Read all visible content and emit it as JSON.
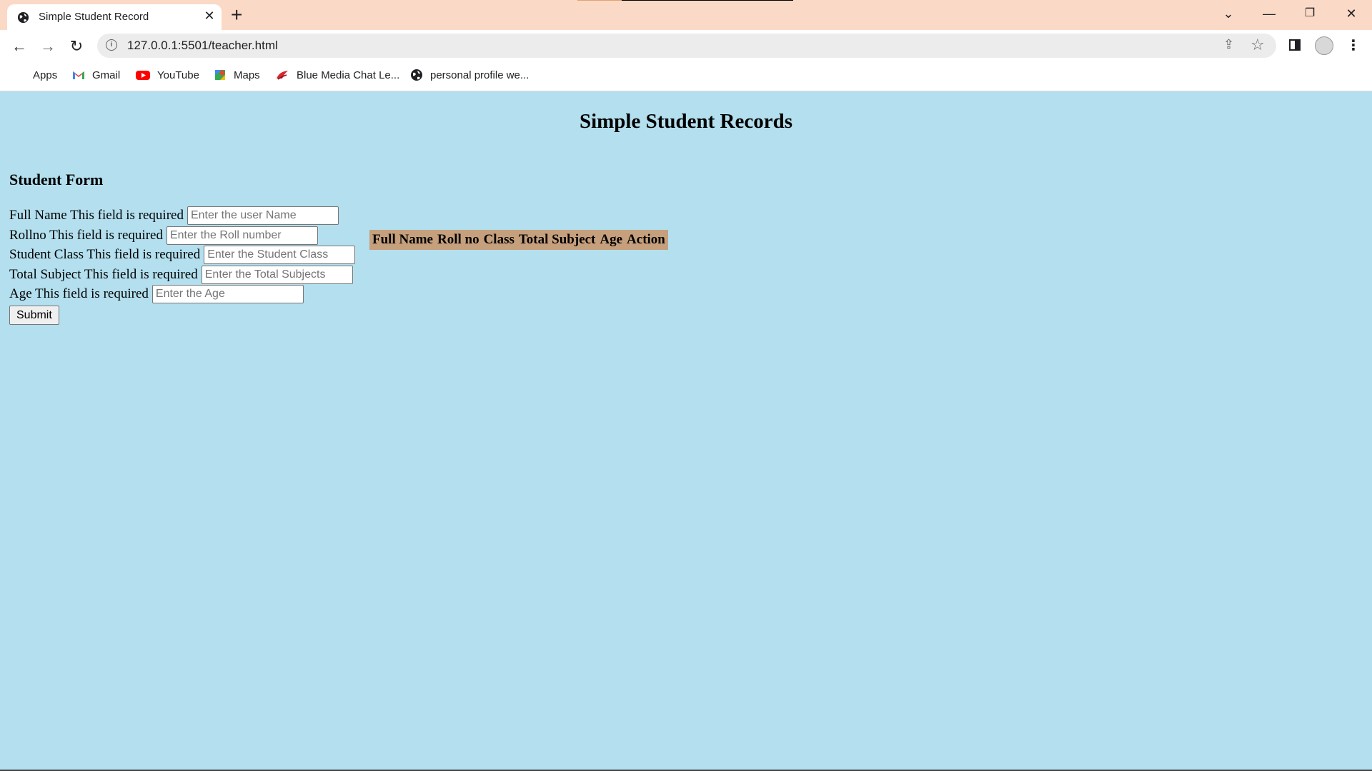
{
  "browser": {
    "tab_title": "Simple Student Record",
    "url": "127.0.0.1:5501/teacher.html",
    "bookmarks": [
      {
        "label": "Apps",
        "icon": "apps-grid-icon"
      },
      {
        "label": "Gmail",
        "icon": "gmail-icon"
      },
      {
        "label": "YouTube",
        "icon": "youtube-icon"
      },
      {
        "label": "Maps",
        "icon": "maps-icon"
      },
      {
        "label": "Blue Media Chat Le...",
        "icon": "bluemedia-icon"
      },
      {
        "label": "personal profile we...",
        "icon": "globe-icon"
      }
    ]
  },
  "page": {
    "title": "Simple Student Records",
    "form_heading": "Student Form",
    "fields": [
      {
        "label": "Full Name This field is required",
        "placeholder": "Enter the user Name"
      },
      {
        "label": "Rollno This field is required",
        "placeholder": "Enter the Roll number"
      },
      {
        "label": "Student Class This field is required",
        "placeholder": "Enter the Student Class"
      },
      {
        "label": "Total Subject This field is required",
        "placeholder": "Enter the Total Subjects"
      },
      {
        "label": "Age This field is required",
        "placeholder": "Enter the Age"
      }
    ],
    "submit_label": "Submit",
    "table_headers": [
      "Full Name",
      "Roll no",
      "Class",
      "Total Subject",
      "Age",
      "Action"
    ]
  },
  "colors": {
    "page_background": "#b3dfee",
    "table_header_background": "#c6a07d",
    "tabstrip_background": "#fbd9c7"
  }
}
